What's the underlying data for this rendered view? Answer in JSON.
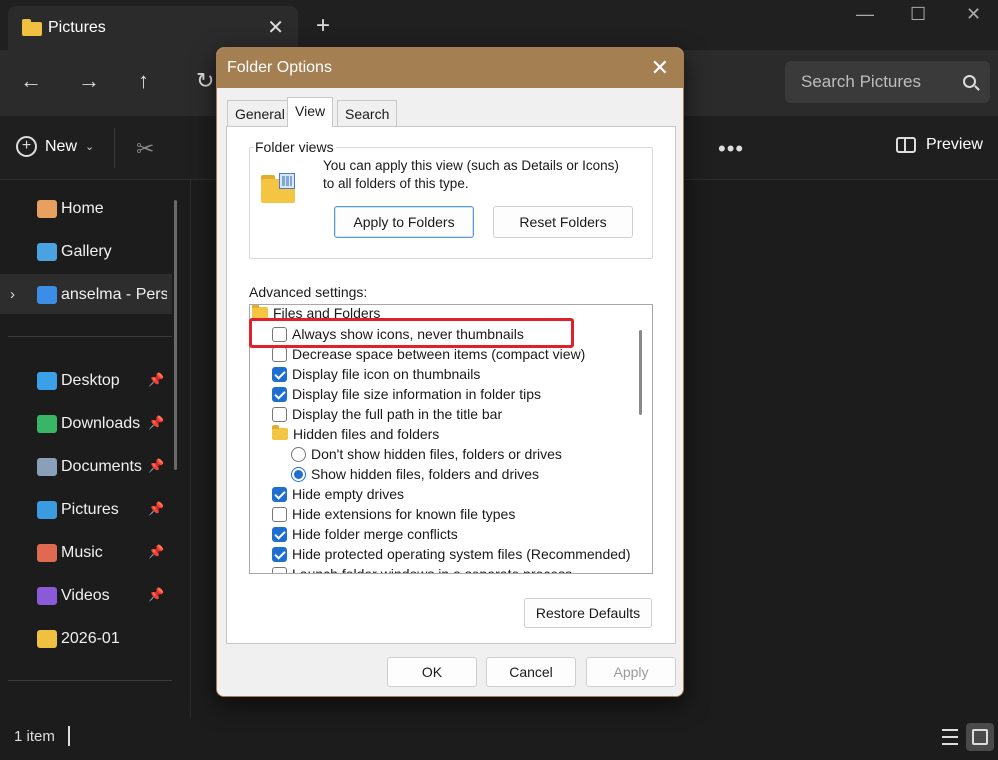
{
  "window": {
    "tab_title": "Pictures",
    "tab_close": "✕",
    "new_tab": "+",
    "minimize": "—",
    "maximize": "☐",
    "close": "✕"
  },
  "navbar": {
    "back": "←",
    "forward": "→",
    "up": "↑",
    "refresh": "↻",
    "search_placeholder": "Search Pictures"
  },
  "toolbar": {
    "new_label": "New",
    "new_chevron": "⌄",
    "cut": "✂",
    "more": "•••",
    "preview_label": "Preview"
  },
  "sidebar": {
    "items": [
      {
        "label": "Home",
        "icon": "home-icon",
        "color": "#e8a060"
      },
      {
        "label": "Gallery",
        "icon": "gallery-icon",
        "color": "#4aa3e0"
      },
      {
        "label": "anselma - Perso",
        "icon": "onedrive-icon",
        "color": "#3a8ee6"
      },
      {
        "label": "Desktop",
        "icon": "desktop-icon",
        "color": "#3aa0e8"
      },
      {
        "label": "Downloads",
        "icon": "downloads-icon",
        "color": "#39b56a"
      },
      {
        "label": "Documents",
        "icon": "documents-icon",
        "color": "#8aa0b8"
      },
      {
        "label": "Pictures",
        "icon": "pictures-icon",
        "color": "#3a9be0"
      },
      {
        "label": "Music",
        "icon": "music-icon",
        "color": "#e06a50"
      },
      {
        "label": "Videos",
        "icon": "videos-icon",
        "color": "#8a5ad8"
      },
      {
        "label": "2026-01",
        "icon": "folder-icon",
        "color": "#f0c040"
      }
    ],
    "pin": "📌",
    "expand": "›"
  },
  "status": {
    "item_count": "1 item"
  },
  "dialog": {
    "title": "Folder Options",
    "close": "✕",
    "tabs": [
      "General",
      "View",
      "Search"
    ],
    "folder_views": {
      "title": "Folder views",
      "text": "You can apply this view (such as Details or Icons) to all folders of this type.",
      "apply_button": "Apply to Folders",
      "reset_button": "Reset Folders"
    },
    "advanced_label": "Advanced settings:",
    "tree": [
      {
        "type": "folder",
        "label": "Files and Folders",
        "checked": false
      },
      {
        "type": "checkbox",
        "label": "Always show icons, never thumbnails",
        "checked": false
      },
      {
        "type": "checkbox",
        "label": "Decrease space between items (compact view)",
        "checked": false
      },
      {
        "type": "checkbox",
        "label": "Display file icon on thumbnails",
        "checked": true
      },
      {
        "type": "checkbox",
        "label": "Display file size information in folder tips",
        "checked": true
      },
      {
        "type": "checkbox",
        "label": "Display the full path in the title bar",
        "checked": false
      },
      {
        "type": "folder",
        "label": "Hidden files and folders",
        "checked": false
      },
      {
        "type": "radio",
        "label": "Don't show hidden files, folders or drives",
        "checked": false
      },
      {
        "type": "radio",
        "label": "Show hidden files, folders and drives",
        "checked": true
      },
      {
        "type": "checkbox",
        "label": "Hide empty drives",
        "checked": true
      },
      {
        "type": "checkbox",
        "label": "Hide extensions for known file types",
        "checked": false
      },
      {
        "type": "checkbox",
        "label": "Hide folder merge conflicts",
        "checked": true
      },
      {
        "type": "checkbox",
        "label": "Hide protected operating system files (Recommended)",
        "checked": true
      },
      {
        "type": "checkbox",
        "label": "Launch folder windows in a separate process",
        "checked": false
      }
    ],
    "restore_button": "Restore Defaults",
    "ok_button": "OK",
    "cancel_button": "Cancel",
    "apply_button": "Apply"
  },
  "colors": {
    "dialog_titlebar": "#a47f52",
    "highlight": "#e0202b",
    "checkbox_accent": "#1f6fd1"
  }
}
